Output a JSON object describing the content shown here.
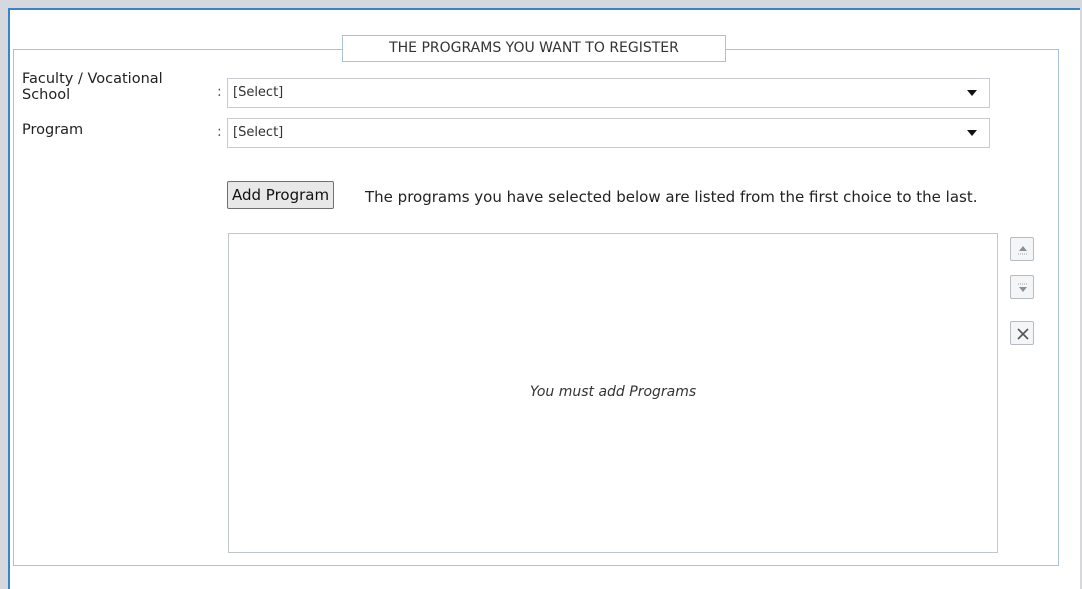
{
  "section": {
    "legend": "THE PROGRAMS YOU WANT TO REGISTER"
  },
  "form": {
    "faculty": {
      "label_line1": "Faculty / Vocational",
      "label_line2": "School",
      "colon": ":",
      "value": "[Select]"
    },
    "program": {
      "label": "Program",
      "colon": ":",
      "value": "[Select]"
    }
  },
  "actions": {
    "add_program_label": "Add Program",
    "hint": "The programs you have selected below are listed from the first choice to the last."
  },
  "list": {
    "empty_message": "You must add Programs"
  },
  "icons": {
    "move_up": "move-up-icon",
    "move_down": "move-down-icon",
    "remove": "close-icon"
  },
  "colors": {
    "panel_border": "#3c82c8",
    "fieldset_border": "#a9c2d8"
  }
}
